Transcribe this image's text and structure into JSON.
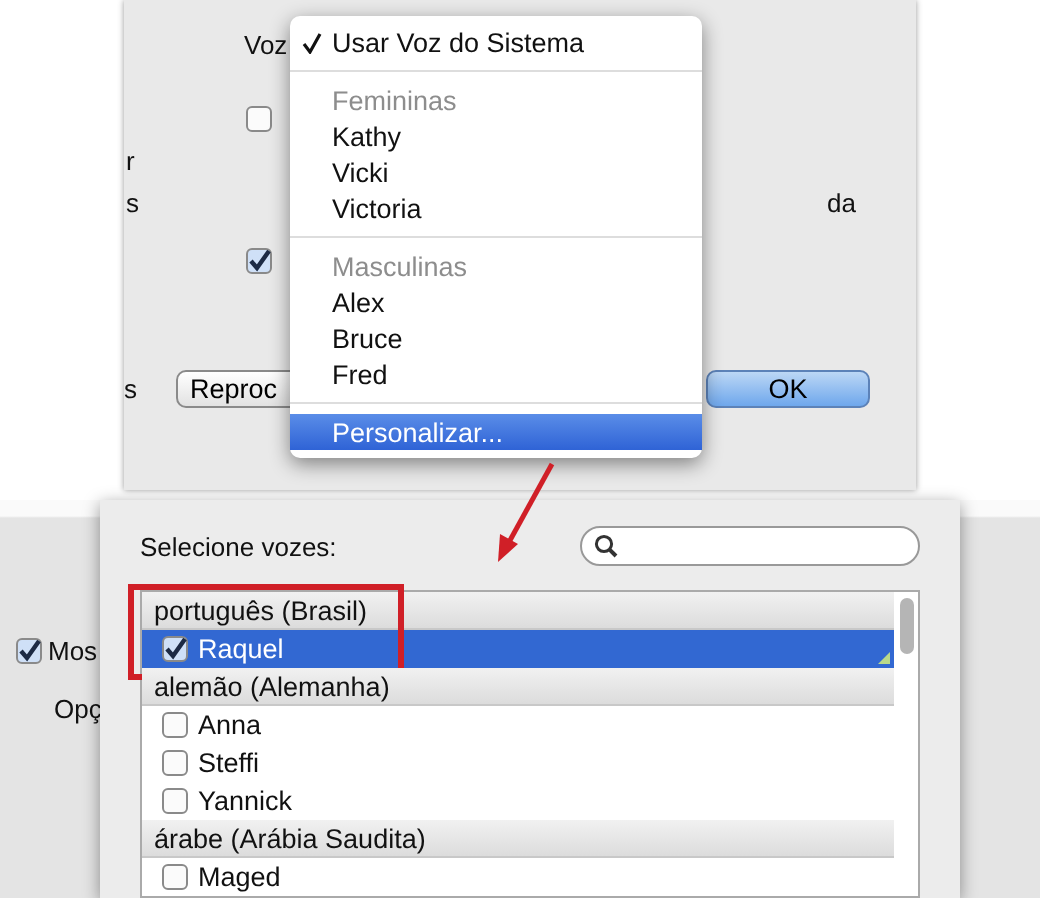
{
  "top_dialog": {
    "voice_label": "Voz",
    "side_letters": [
      "r",
      "s"
    ],
    "right_fragment": "da",
    "bottom_letter": "s",
    "checkboxes": [
      {
        "checked": false
      },
      {
        "checked": true
      }
    ],
    "buttons": [
      {
        "label": "Reproc",
        "default": false
      },
      {
        "label": "OK",
        "default": true
      }
    ],
    "menu": {
      "items": [
        {
          "kind": "item",
          "label": "Usar Voz do Sistema",
          "checked": true,
          "selected": false
        },
        {
          "kind": "separator"
        },
        {
          "kind": "header",
          "label": "Femininas"
        },
        {
          "kind": "item",
          "label": "Kathy",
          "checked": false,
          "selected": false
        },
        {
          "kind": "item",
          "label": "Vicki",
          "checked": false,
          "selected": false
        },
        {
          "kind": "item",
          "label": "Victoria",
          "checked": false,
          "selected": false
        },
        {
          "kind": "separator"
        },
        {
          "kind": "header",
          "label": "Masculinas"
        },
        {
          "kind": "item",
          "label": "Alex",
          "checked": false,
          "selected": false
        },
        {
          "kind": "item",
          "label": "Bruce",
          "checked": false,
          "selected": false
        },
        {
          "kind": "item",
          "label": "Fred",
          "checked": false,
          "selected": false
        },
        {
          "kind": "separator"
        },
        {
          "kind": "item",
          "label": "Personalizar...",
          "checked": false,
          "selected": true
        }
      ]
    }
  },
  "bottom_dialog": {
    "background": {
      "checkbox_label": "Mos",
      "checked": true,
      "label": "Opç"
    },
    "prompt": "Selecione vozes:",
    "voice_groups": [
      {
        "group": "português (Brasil)",
        "highlighted": true,
        "voices": [
          {
            "name": "Raquel",
            "checked": true,
            "selected": true
          }
        ]
      },
      {
        "group": "alemão (Alemanha)",
        "highlighted": false,
        "voices": [
          {
            "name": "Anna",
            "checked": false,
            "selected": false
          },
          {
            "name": "Steffi",
            "checked": false,
            "selected": false
          },
          {
            "name": "Yannick",
            "checked": false,
            "selected": false
          }
        ]
      },
      {
        "group": "árabe (Arábia Saudita)",
        "highlighted": false,
        "voices": [
          {
            "name": "Maged",
            "checked": false,
            "selected": false
          }
        ]
      }
    ]
  }
}
